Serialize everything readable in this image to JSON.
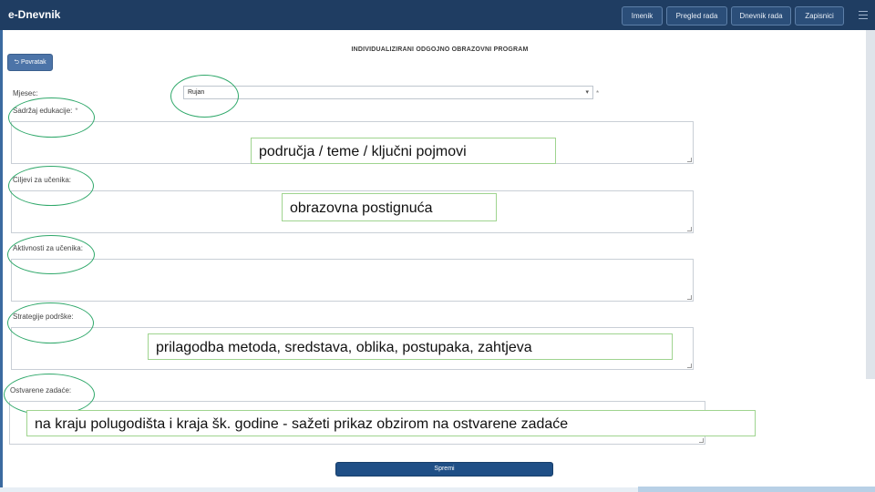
{
  "app": {
    "brand": "e-Dnevnik"
  },
  "nav": {
    "items": [
      {
        "label": "Imenik"
      },
      {
        "label": "Pregled rada"
      },
      {
        "label": "Dnevnik rada"
      },
      {
        "label": "Zapisnici"
      }
    ]
  },
  "page": {
    "title": "INDIVIDUALIZIRANI ODGOJNO OBRAZOVNI PROGRAM",
    "back_label": "⮌ Povratak",
    "submit_label": "Spremi"
  },
  "form": {
    "month": {
      "label": "Mjesec:",
      "value": "Rujan",
      "required_mark": "*"
    },
    "content": {
      "label": "Sadržaj edukacije:",
      "required_mark": "*"
    },
    "goals": {
      "label": "Ciljevi za učenika:"
    },
    "activities": {
      "label": "Aktivnosti za učenika:"
    },
    "strategies": {
      "label": "Strategije podrške:"
    },
    "achieved": {
      "label": "Ostvarene zadaće:"
    }
  },
  "overlays": {
    "content_hint": "područja / teme / ključni pojmovi",
    "goals_hint": "obrazovna postignuća",
    "strategies_hint": "prilagodba metoda, sredstava, oblika, postupaka, zahtjeva",
    "achieved_hint": "na kraju polugodišta i kraja šk. godine - sažeti prikaz obzirom na ostvarene zadaće"
  }
}
